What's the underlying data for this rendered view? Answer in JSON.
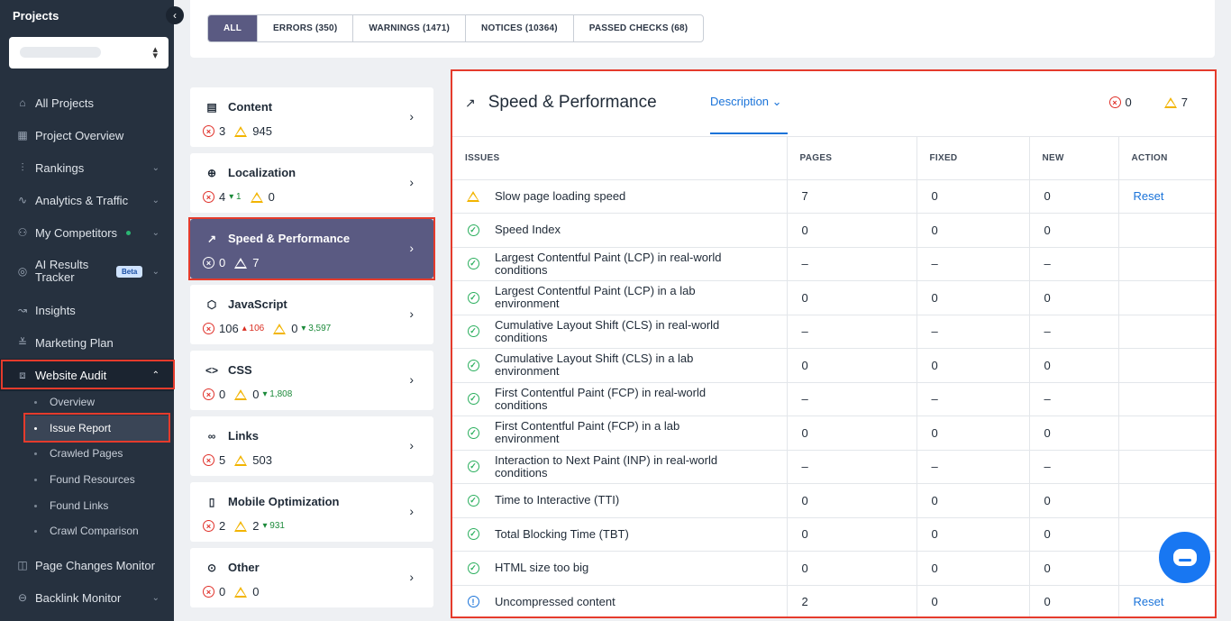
{
  "sidebar": {
    "title": "Projects",
    "collapse_icon": "‹",
    "nav": [
      {
        "label": "All Projects",
        "icon": "⌂"
      },
      {
        "label": "Project Overview",
        "icon": "▦"
      },
      {
        "label": "Rankings",
        "icon": "⫶"
      },
      {
        "label": "Analytics & Traffic",
        "icon": "∿"
      },
      {
        "label": "My Competitors",
        "icon": "⚇"
      },
      {
        "label": "AI Results Tracker",
        "icon": "◎",
        "badge": "Beta"
      },
      {
        "label": "Insights",
        "icon": "↝"
      },
      {
        "label": "Marketing Plan",
        "icon": "≚"
      },
      {
        "label": "Website Audit",
        "icon": "⧈"
      }
    ],
    "audit_sub": [
      {
        "label": "Overview"
      },
      {
        "label": "Issue Report"
      },
      {
        "label": "Crawled Pages"
      },
      {
        "label": "Found Resources"
      },
      {
        "label": "Found Links"
      },
      {
        "label": "Crawl Comparison"
      }
    ],
    "bottom_nav": [
      {
        "label": "Page Changes Monitor",
        "icon": "◫"
      },
      {
        "label": "Backlink Monitor",
        "icon": "⊖"
      }
    ]
  },
  "filters": [
    {
      "label": "ALL"
    },
    {
      "label": "ERRORS (350)"
    },
    {
      "label": "WARNINGS (1471)"
    },
    {
      "label": "NOTICES (10364)"
    },
    {
      "label": "PASSED CHECKS (68)"
    }
  ],
  "categories": [
    {
      "name": "Content",
      "icon": "▤",
      "errors": "3",
      "warnings": "945"
    },
    {
      "name": "Localization",
      "icon": "⊕",
      "errors": "4",
      "err_delta": "▾ 1",
      "warnings": "0"
    },
    {
      "name": "Speed & Performance",
      "icon": "↗",
      "errors": "0",
      "warnings": "7"
    },
    {
      "name": "JavaScript",
      "icon": "⬡",
      "errors": "106",
      "err_delta": "▴ 106",
      "warnings": "0",
      "warn_delta": "▾ 3,597"
    },
    {
      "name": "CSS",
      "icon": "<>",
      "errors": "0",
      "warnings": "0",
      "warn_delta": "▾ 1,808"
    },
    {
      "name": "Links",
      "icon": "∞",
      "errors": "5",
      "warnings": "503"
    },
    {
      "name": "Mobile Optimization",
      "icon": "▯",
      "errors": "2",
      "warnings": "2",
      "warn_delta": "▾ 931"
    },
    {
      "name": "Other",
      "icon": "⊙",
      "errors": "0",
      "warnings": "0"
    }
  ],
  "panel": {
    "title": "Speed & Performance",
    "title_icon": "↗",
    "description_tab": "Description ⌄",
    "errors": "0",
    "warnings": "7",
    "columns": [
      "ISSUES",
      "PAGES",
      "FIXED",
      "NEW",
      "ACTION"
    ],
    "rows": [
      {
        "status": "warning",
        "issue": "Slow page loading speed",
        "pages": "7",
        "fixed": "0",
        "new": "0",
        "action": "Reset"
      },
      {
        "status": "ok",
        "issue": "Speed Index",
        "pages": "0",
        "fixed": "0",
        "new": "0",
        "action": ""
      },
      {
        "status": "ok",
        "issue": "Largest Contentful Paint (LCP) in real-world conditions",
        "pages": "–",
        "fixed": "–",
        "new": "–",
        "action": ""
      },
      {
        "status": "ok",
        "issue": "Largest Contentful Paint (LCP) in a lab environment",
        "pages": "0",
        "fixed": "0",
        "new": "0",
        "action": ""
      },
      {
        "status": "ok",
        "issue": "Cumulative Layout Shift (CLS) in real-world conditions",
        "pages": "–",
        "fixed": "–",
        "new": "–",
        "action": ""
      },
      {
        "status": "ok",
        "issue": "Cumulative Layout Shift (CLS) in a lab environment",
        "pages": "0",
        "fixed": "0",
        "new": "0",
        "action": ""
      },
      {
        "status": "ok",
        "issue": "First Contentful Paint (FCP) in real-world conditions",
        "pages": "–",
        "fixed": "–",
        "new": "–",
        "action": ""
      },
      {
        "status": "ok",
        "issue": "First Contentful Paint (FCP) in a lab environment",
        "pages": "0",
        "fixed": "0",
        "new": "0",
        "action": ""
      },
      {
        "status": "ok",
        "issue": "Interaction to Next Paint (INP) in real-world conditions",
        "pages": "–",
        "fixed": "–",
        "new": "–",
        "action": ""
      },
      {
        "status": "ok",
        "issue": "Time to Interactive (TTI)",
        "pages": "0",
        "fixed": "0",
        "new": "0",
        "action": ""
      },
      {
        "status": "ok",
        "issue": "Total Blocking Time (TBT)",
        "pages": "0",
        "fixed": "0",
        "new": "0",
        "action": ""
      },
      {
        "status": "ok",
        "issue": "HTML size too big",
        "pages": "0",
        "fixed": "0",
        "new": "0",
        "action": ""
      },
      {
        "status": "info",
        "issue": "Uncompressed content",
        "pages": "2",
        "fixed": "0",
        "new": "0",
        "action": "Reset"
      }
    ]
  },
  "colors": {
    "accent": "#5a5a82",
    "highlight": "#e53b2c",
    "link": "#1a73d9",
    "sidebar": "#26313f"
  }
}
